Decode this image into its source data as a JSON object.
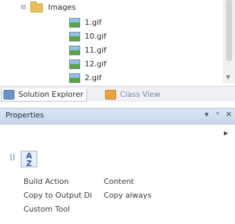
{
  "solution_explorer": {
    "folder": {
      "label": "Images"
    },
    "files": [
      {
        "label": "1.gif"
      },
      {
        "label": "10.gif"
      },
      {
        "label": "11.gif"
      },
      {
        "label": "12.gif"
      },
      {
        "label": "2.gif"
      }
    ]
  },
  "tabs": [
    {
      "label": "Solution Explorer"
    },
    {
      "label": "Class View"
    }
  ],
  "properties": {
    "title": "Properties",
    "buttons": {
      "pin": "▾",
      "autohide": "ᵒ",
      "close": "✕"
    },
    "rows": [
      {
        "name": "Build Action",
        "value": "Content"
      },
      {
        "name": "Copy to Output Di",
        "value": "Copy always"
      },
      {
        "name": "Custom Tool",
        "value": ""
      }
    ]
  },
  "icons": {
    "expander": "collapse-icon",
    "folder": "folder-icon",
    "image": "image-file-icon",
    "categorized": "categorized-icon",
    "alphabetical": "alphabetical-sort-icon"
  }
}
